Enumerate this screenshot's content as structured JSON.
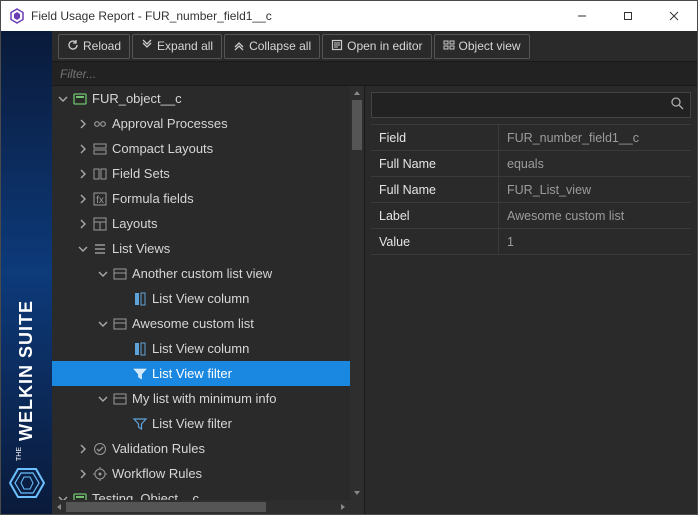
{
  "window": {
    "title": "Field Usage Report - FUR_number_field1__c"
  },
  "toolbar": {
    "reload": "Reload",
    "expand": "Expand all",
    "collapse": "Collapse all",
    "open": "Open in editor",
    "objectview": "Object view"
  },
  "filter": {
    "placeholder": "Filter..."
  },
  "tree": {
    "root": "FUR_object__c",
    "approval": "Approval Processes",
    "compact": "Compact Layouts",
    "fieldsets": "Field Sets",
    "formula": "Formula fields",
    "layouts": "Layouts",
    "listviews": "List Views",
    "another": "Another custom list view",
    "another_col": "List View column",
    "awesome": "Awesome custom list",
    "awesome_col": "List View column",
    "awesome_filter": "List View filter",
    "mylist": "My list with minimum info",
    "mylist_filter": "List View filter",
    "validation": "Validation Rules",
    "workflow": "Workflow Rules",
    "testing": "Testing_Object__c"
  },
  "properties": [
    {
      "k": "Field",
      "v": "FUR_number_field1__c"
    },
    {
      "k": "Full Name",
      "v": "equals"
    },
    {
      "k": "Full Name",
      "v": "FUR_List_view"
    },
    {
      "k": "Label",
      "v": "Awesome custom list"
    },
    {
      "k": "Value",
      "v": "1"
    }
  ]
}
